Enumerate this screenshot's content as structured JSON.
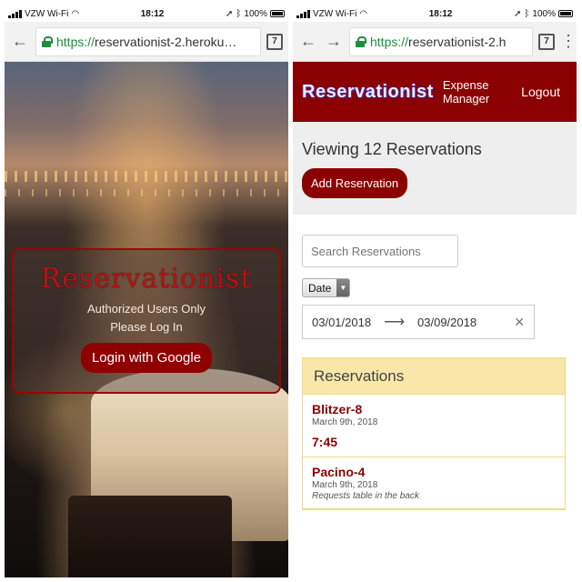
{
  "left": {
    "status": {
      "carrier": "VZW Wi-Fi",
      "time": "18:12",
      "battery": "100%"
    },
    "browser": {
      "url_scheme": "https://",
      "url_host": "reservationist-2.heroku…",
      "tab_count": "7"
    },
    "card": {
      "title": "Reservationist",
      "line1": "Authorized Users Only",
      "line2": "Please Log In",
      "button": "Login with Google"
    }
  },
  "right": {
    "status": {
      "carrier": "VZW Wi-Fi",
      "time": "18:12",
      "battery": "100%"
    },
    "browser": {
      "url_scheme": "https://",
      "url_host": "reservationist-2.h",
      "tab_count": "7"
    },
    "header": {
      "brand": "Reservationist",
      "expense_line1": "Expense",
      "expense_line2": "Manager",
      "logout": "Logout"
    },
    "summary": {
      "viewing": "Viewing 12 Reservations",
      "add_button": "Add Reservation"
    },
    "filters": {
      "search_placeholder": "Search Reservations",
      "filter_type": "Date",
      "date_start": "03/01/2018",
      "date_end": "03/09/2018"
    },
    "reservations": {
      "heading": "Reservations",
      "items": [
        {
          "name": "Blitzer-8",
          "date": "March 9th, 2018",
          "time": "7:45"
        },
        {
          "name": "Pacino-4",
          "date": "March 9th, 2018",
          "note": "Requests table in the back"
        }
      ]
    }
  }
}
